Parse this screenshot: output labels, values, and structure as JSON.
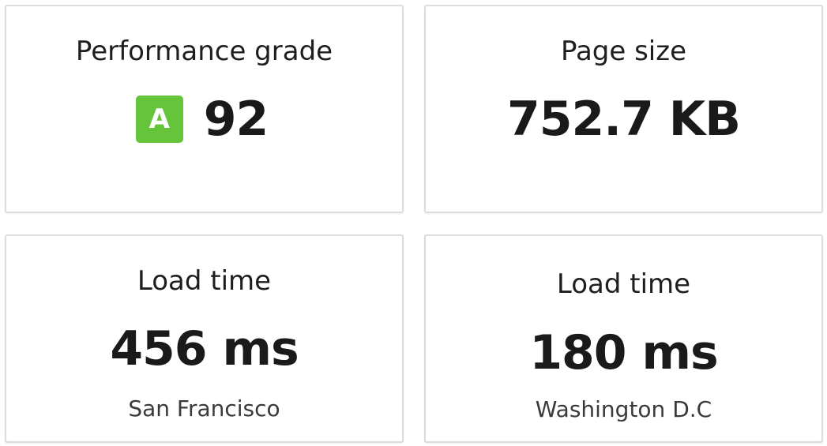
{
  "colors": {
    "grade_badge_bg": "#66c43a",
    "card_border": "#dcdcdc",
    "text_primary": "#1a1a1a"
  },
  "performance": {
    "label": "Performance grade",
    "grade": "A",
    "score": "92"
  },
  "page_size": {
    "label": "Page size",
    "value": "752.7 KB"
  },
  "load_time_sf": {
    "label": "Load time",
    "value": "456 ms",
    "location": "San Francisco"
  },
  "load_time_dc": {
    "label": "Load time",
    "value": "180 ms",
    "location": "Washington D.C"
  }
}
